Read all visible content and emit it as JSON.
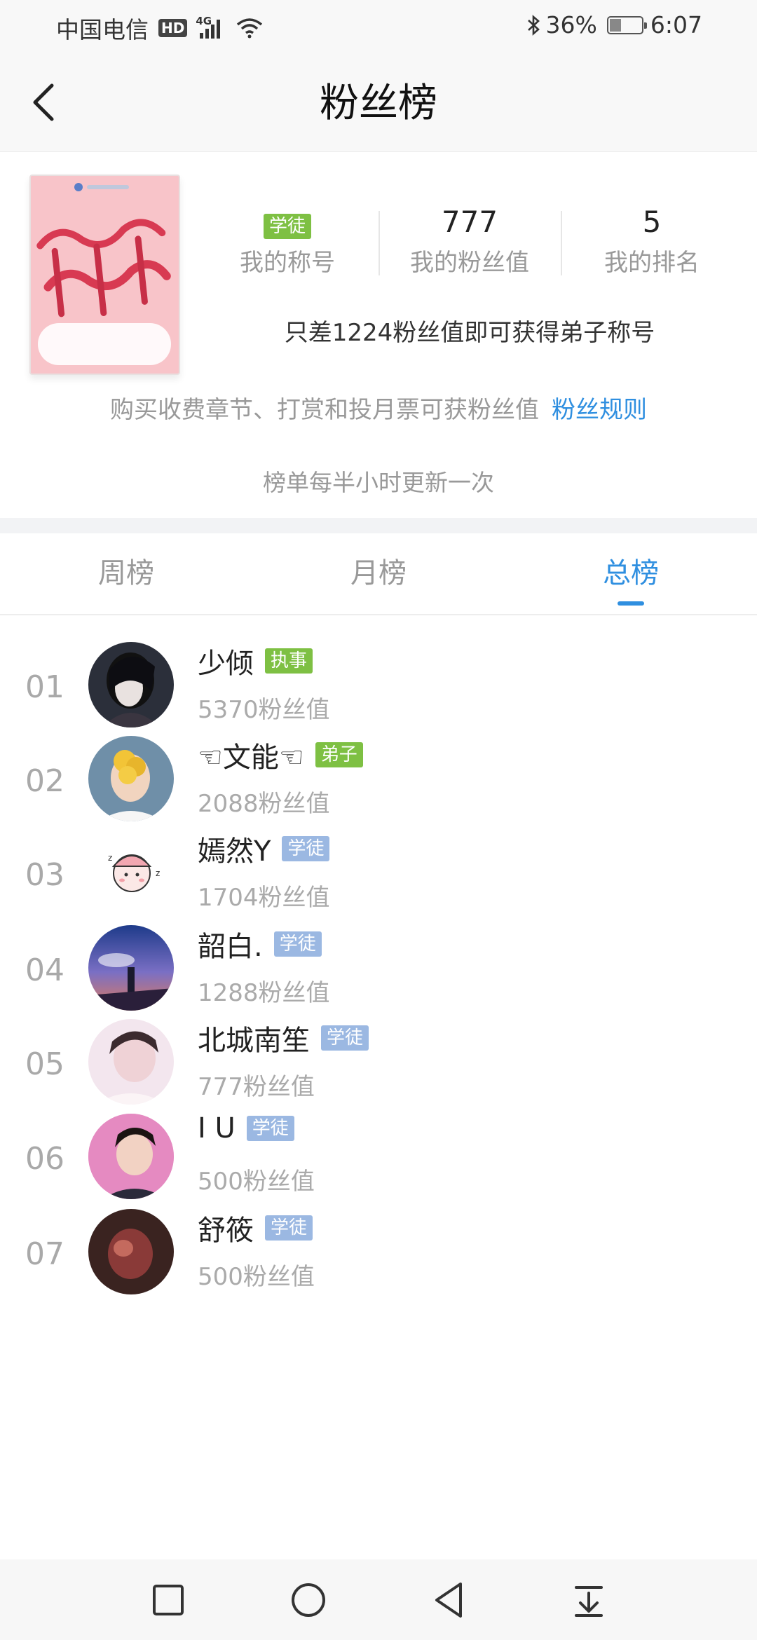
{
  "status_bar": {
    "carrier": "中国电信",
    "hd": "HD",
    "network": "4G",
    "battery_percent": "36%",
    "battery_level": 0.36,
    "time": "6:07"
  },
  "nav": {
    "title": "粉丝榜"
  },
  "profile": {
    "title_badge": "学徒",
    "title_label": "我的称号",
    "fans_value": "777",
    "fans_label": "我的粉丝值",
    "rank_value": "5",
    "rank_label": "我的排名",
    "hint": "只差1224粉丝值即可获得弟子称号",
    "rule_text": "购买收费章节、打赏和投月票可获粉丝值",
    "rule_link": "粉丝规则",
    "update_text": "榜单每半小时更新一次"
  },
  "tabs": [
    {
      "label": "周榜",
      "active": false
    },
    {
      "label": "月榜",
      "active": false
    },
    {
      "label": "总榜",
      "active": true
    }
  ],
  "ranking": [
    {
      "rank": "01",
      "name": "少倾",
      "badge": "执事",
      "badge_color": "#7ec043",
      "fans": "5370粉丝值"
    },
    {
      "rank": "02",
      "name": "☜文能☜",
      "badge": "弟子",
      "badge_color": "#7ec043",
      "fans": "2088粉丝值"
    },
    {
      "rank": "03",
      "name": "嫣然Y",
      "badge": "学徒",
      "badge_color": "#9bb8e2",
      "fans": "1704粉丝值"
    },
    {
      "rank": "04",
      "name": "韶白.",
      "badge": "学徒",
      "badge_color": "#9bb8e2",
      "fans": "1288粉丝值"
    },
    {
      "rank": "05",
      "name": "北城南笙",
      "badge": "学徒",
      "badge_color": "#9bb8e2",
      "fans": "777粉丝值"
    },
    {
      "rank": "06",
      "name": "I U",
      "badge": "学徒",
      "badge_color": "#9bb8e2",
      "fans": "500粉丝值"
    },
    {
      "rank": "07",
      "name": "舒筱",
      "badge": "学徒",
      "badge_color": "#9bb8e2",
      "fans": "500粉丝值"
    }
  ],
  "icons": {
    "back": "chevron-left-icon",
    "recents": "square-icon",
    "home": "circle-icon",
    "system_back": "triangle-back-icon",
    "notifications": "pull-down-icon"
  },
  "colors": {
    "accent": "#2f8fe0",
    "badge_green": "#7ec043",
    "badge_blue": "#9bb8e2"
  }
}
